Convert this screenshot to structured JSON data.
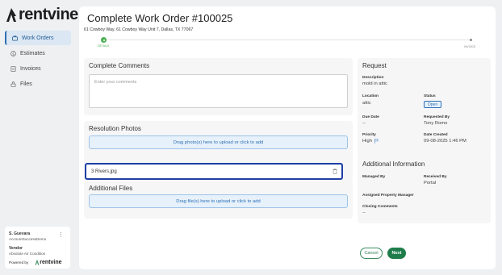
{
  "brand": {
    "name": "rentvine"
  },
  "nav": {
    "items": [
      {
        "label": "Work Orders",
        "icon": "tool-icon",
        "active": true
      },
      {
        "label": "Estimates",
        "icon": "dollar-icon",
        "active": false
      },
      {
        "label": "Invoices",
        "icon": "document-icon",
        "active": false
      },
      {
        "label": "Files",
        "icon": "lock-icon",
        "active": false
      }
    ]
  },
  "user": {
    "name": "S. Guevara",
    "account": "AccountSuccessDemo",
    "vendor_label": "Vendor",
    "vendor_name": "Absolute Air Condition",
    "powered_by": "Powered by",
    "powered_brand": "rentvine"
  },
  "work_order": {
    "title": "Complete Work Order #100025",
    "address": "61 Cowboy Way, 61 Cowboy Way Unit 7, Dallas, TX 77067"
  },
  "progress": {
    "steps": [
      {
        "label": "DETAILS",
        "state": "complete"
      },
      {
        "label": "INVOICE",
        "state": "pending"
      }
    ]
  },
  "complete_comments": {
    "title": "Complete Comments",
    "placeholder": "Enter your comments"
  },
  "resolution_photos": {
    "title": "Resolution Photos",
    "upload_label": "Drag photo(s) here to upload or click to add",
    "files": [
      "3 Rivers.jpg"
    ]
  },
  "additional_files": {
    "title": "Additional Files",
    "upload_label": "Drag file(s) here to upload or click to add"
  },
  "request": {
    "title": "Request",
    "description_label": "Description",
    "description": "mold in attic",
    "location_label": "Location",
    "location": "attic",
    "status_label": "Status",
    "status": "Open",
    "due_date_label": "Due Date",
    "due_date": "--",
    "requested_by_label": "Requested By",
    "requested_by": "Tony Romo",
    "priority_label": "Priority",
    "priority": "High",
    "date_created_label": "Date Created",
    "date_created": "09-08-2025 1:46 PM"
  },
  "additional_info": {
    "title": "Additional Information",
    "managed_by_label": "Managed By",
    "managed_by": "",
    "received_by_label": "Received By",
    "received_by": "Portal",
    "assigned_pm_label": "Assigned Property Manager",
    "assigned_pm": "",
    "closing_comments_label": "Closing Comments",
    "closing_comments": "--"
  },
  "actions": {
    "cancel": "Cancel",
    "next": "Next"
  },
  "colors": {
    "accent": "#2f6fb5",
    "success": "#4caf50",
    "primary_button": "#1e7d4a",
    "focus_border": "#1f3fa5"
  }
}
